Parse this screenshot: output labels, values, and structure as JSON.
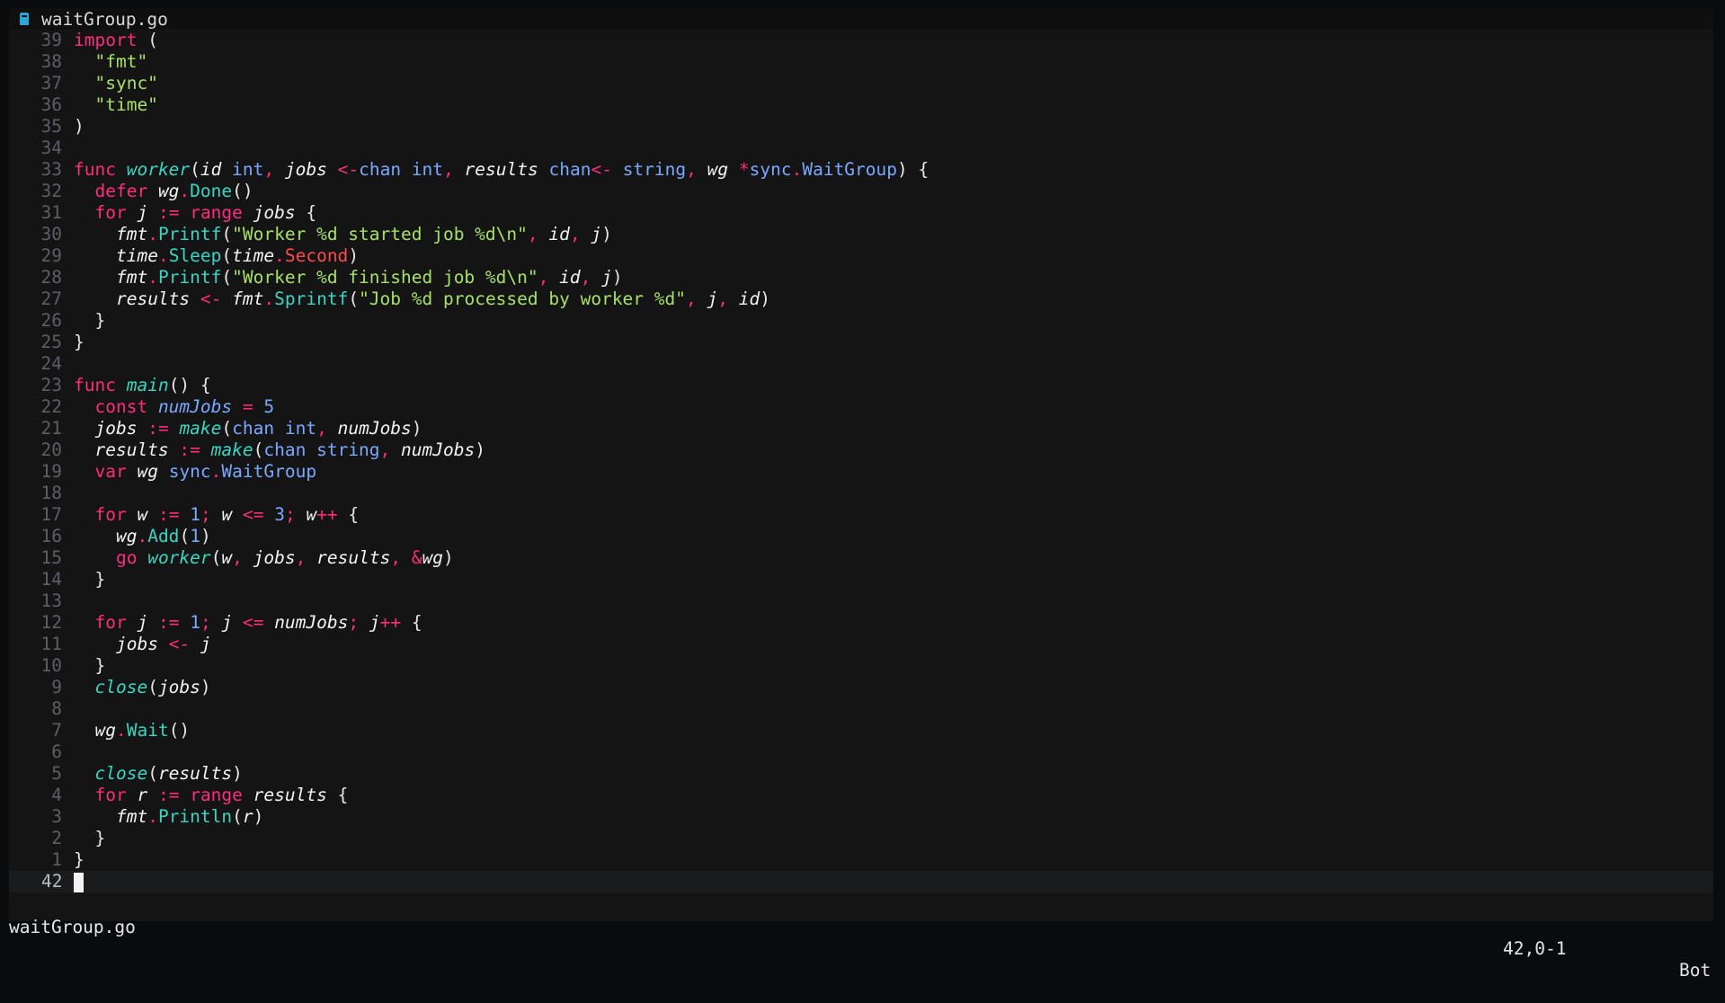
{
  "tab": {
    "icon": "file-icon",
    "title": "waitGroup.go"
  },
  "lines": [
    {
      "n": "39",
      "t": [
        [
          "k",
          "import"
        ],
        [
          "p",
          " ("
        ]
      ]
    },
    {
      "n": "38",
      "t": [
        [
          "p",
          "  "
        ],
        [
          "s",
          "\"fmt\""
        ]
      ]
    },
    {
      "n": "37",
      "t": [
        [
          "p",
          "  "
        ],
        [
          "s",
          "\"sync\""
        ]
      ]
    },
    {
      "n": "36",
      "t": [
        [
          "p",
          "  "
        ],
        [
          "s",
          "\"time\""
        ]
      ]
    },
    {
      "n": "35",
      "t": [
        [
          "p",
          ")"
        ]
      ]
    },
    {
      "n": "34",
      "t": []
    },
    {
      "n": "33",
      "t": [
        [
          "k",
          "func"
        ],
        [
          "p",
          " "
        ],
        [
          "f",
          "worker"
        ],
        [
          "p",
          "("
        ],
        [
          "v",
          "id"
        ],
        [
          "p",
          " "
        ],
        [
          "t",
          "int"
        ],
        [
          "k",
          ","
        ],
        [
          "p",
          " "
        ],
        [
          "v",
          "jobs"
        ],
        [
          "p",
          " "
        ],
        [
          "k",
          "<-"
        ],
        [
          "t",
          "chan"
        ],
        [
          "p",
          " "
        ],
        [
          "t",
          "int"
        ],
        [
          "k",
          ","
        ],
        [
          "p",
          " "
        ],
        [
          "v",
          "results"
        ],
        [
          "p",
          " "
        ],
        [
          "t",
          "chan"
        ],
        [
          "k",
          "<-"
        ],
        [
          "p",
          " "
        ],
        [
          "t",
          "string"
        ],
        [
          "k",
          ","
        ],
        [
          "p",
          " "
        ],
        [
          "v",
          "wg"
        ],
        [
          "p",
          " "
        ],
        [
          "k",
          "*"
        ],
        [
          "t",
          "sync"
        ],
        [
          "k",
          "."
        ],
        [
          "t",
          "WaitGroup"
        ],
        [
          "p",
          ") {"
        ]
      ]
    },
    {
      "n": "32",
      "t": [
        [
          "p",
          "  "
        ],
        [
          "k",
          "defer"
        ],
        [
          "p",
          " "
        ],
        [
          "v",
          "wg"
        ],
        [
          "k",
          "."
        ],
        [
          "m",
          "Done"
        ],
        [
          "p",
          "()"
        ]
      ]
    },
    {
      "n": "31",
      "t": [
        [
          "p",
          "  "
        ],
        [
          "k",
          "for"
        ],
        [
          "p",
          " "
        ],
        [
          "v",
          "j"
        ],
        [
          "p",
          " "
        ],
        [
          "k",
          ":="
        ],
        [
          "p",
          " "
        ],
        [
          "k",
          "range"
        ],
        [
          "p",
          " "
        ],
        [
          "v",
          "jobs"
        ],
        [
          "p",
          " {"
        ]
      ]
    },
    {
      "n": "30",
      "t": [
        [
          "p",
          "    "
        ],
        [
          "v",
          "fmt"
        ],
        [
          "k",
          "."
        ],
        [
          "m",
          "Printf"
        ],
        [
          "p",
          "("
        ],
        [
          "s",
          "\"Worker %d started job %d\\n\""
        ],
        [
          "k",
          ","
        ],
        [
          "p",
          " "
        ],
        [
          "v",
          "id"
        ],
        [
          "k",
          ","
        ],
        [
          "p",
          " "
        ],
        [
          "v",
          "j"
        ],
        [
          "p",
          ")"
        ]
      ]
    },
    {
      "n": "29",
      "t": [
        [
          "p",
          "    "
        ],
        [
          "v",
          "time"
        ],
        [
          "k",
          "."
        ],
        [
          "m",
          "Sleep"
        ],
        [
          "p",
          "("
        ],
        [
          "v",
          "time"
        ],
        [
          "k",
          "."
        ],
        [
          "c",
          "Second"
        ],
        [
          "p",
          ")"
        ]
      ]
    },
    {
      "n": "28",
      "t": [
        [
          "p",
          "    "
        ],
        [
          "v",
          "fmt"
        ],
        [
          "k",
          "."
        ],
        [
          "m",
          "Printf"
        ],
        [
          "p",
          "("
        ],
        [
          "s",
          "\"Worker %d finished job %d\\n\""
        ],
        [
          "k",
          ","
        ],
        [
          "p",
          " "
        ],
        [
          "v",
          "id"
        ],
        [
          "k",
          ","
        ],
        [
          "p",
          " "
        ],
        [
          "v",
          "j"
        ],
        [
          "p",
          ")"
        ]
      ]
    },
    {
      "n": "27",
      "t": [
        [
          "p",
          "    "
        ],
        [
          "v",
          "results"
        ],
        [
          "p",
          " "
        ],
        [
          "k",
          "<-"
        ],
        [
          "p",
          " "
        ],
        [
          "v",
          "fmt"
        ],
        [
          "k",
          "."
        ],
        [
          "m",
          "Sprintf"
        ],
        [
          "p",
          "("
        ],
        [
          "s",
          "\"Job %d processed by worker %d\""
        ],
        [
          "k",
          ","
        ],
        [
          "p",
          " "
        ],
        [
          "v",
          "j"
        ],
        [
          "k",
          ","
        ],
        [
          "p",
          " "
        ],
        [
          "v",
          "id"
        ],
        [
          "p",
          ")"
        ]
      ]
    },
    {
      "n": "26",
      "t": [
        [
          "p",
          "  }"
        ]
      ]
    },
    {
      "n": "25",
      "t": [
        [
          "p",
          "}"
        ]
      ]
    },
    {
      "n": "24",
      "t": []
    },
    {
      "n": "23",
      "t": [
        [
          "k",
          "func"
        ],
        [
          "p",
          " "
        ],
        [
          "f",
          "main"
        ],
        [
          "p",
          "() {"
        ]
      ]
    },
    {
      "n": "22",
      "t": [
        [
          "p",
          "  "
        ],
        [
          "k",
          "const"
        ],
        [
          "p",
          " "
        ],
        [
          "ci",
          "numJobs"
        ],
        [
          "p",
          " "
        ],
        [
          "k",
          "="
        ],
        [
          "p",
          " "
        ],
        [
          "n",
          "5"
        ]
      ]
    },
    {
      "n": "21",
      "t": [
        [
          "p",
          "  "
        ],
        [
          "v",
          "jobs"
        ],
        [
          "p",
          " "
        ],
        [
          "k",
          ":="
        ],
        [
          "p",
          " "
        ],
        [
          "f",
          "make"
        ],
        [
          "p",
          "("
        ],
        [
          "t",
          "chan"
        ],
        [
          "p",
          " "
        ],
        [
          "t",
          "int"
        ],
        [
          "k",
          ","
        ],
        [
          "p",
          " "
        ],
        [
          "v",
          "numJobs"
        ],
        [
          "p",
          ")"
        ]
      ]
    },
    {
      "n": "20",
      "t": [
        [
          "p",
          "  "
        ],
        [
          "v",
          "results"
        ],
        [
          "p",
          " "
        ],
        [
          "k",
          ":="
        ],
        [
          "p",
          " "
        ],
        [
          "f",
          "make"
        ],
        [
          "p",
          "("
        ],
        [
          "t",
          "chan"
        ],
        [
          "p",
          " "
        ],
        [
          "t",
          "string"
        ],
        [
          "k",
          ","
        ],
        [
          "p",
          " "
        ],
        [
          "v",
          "numJobs"
        ],
        [
          "p",
          ")"
        ]
      ]
    },
    {
      "n": "19",
      "t": [
        [
          "p",
          "  "
        ],
        [
          "k",
          "var"
        ],
        [
          "p",
          " "
        ],
        [
          "v",
          "wg"
        ],
        [
          "p",
          " "
        ],
        [
          "t",
          "sync"
        ],
        [
          "k",
          "."
        ],
        [
          "t",
          "WaitGroup"
        ]
      ]
    },
    {
      "n": "18",
      "t": []
    },
    {
      "n": "17",
      "t": [
        [
          "p",
          "  "
        ],
        [
          "k",
          "for"
        ],
        [
          "p",
          " "
        ],
        [
          "v",
          "w"
        ],
        [
          "p",
          " "
        ],
        [
          "k",
          ":="
        ],
        [
          "p",
          " "
        ],
        [
          "n",
          "1"
        ],
        [
          "k",
          ";"
        ],
        [
          "p",
          " "
        ],
        [
          "v",
          "w"
        ],
        [
          "p",
          " "
        ],
        [
          "k",
          "<="
        ],
        [
          "p",
          " "
        ],
        [
          "n",
          "3"
        ],
        [
          "k",
          ";"
        ],
        [
          "p",
          " "
        ],
        [
          "v",
          "w"
        ],
        [
          "k",
          "++"
        ],
        [
          "p",
          " {"
        ]
      ]
    },
    {
      "n": "16",
      "t": [
        [
          "p",
          "    "
        ],
        [
          "v",
          "wg"
        ],
        [
          "k",
          "."
        ],
        [
          "m",
          "Add"
        ],
        [
          "p",
          "("
        ],
        [
          "n",
          "1"
        ],
        [
          "p",
          ")"
        ]
      ]
    },
    {
      "n": "15",
      "t": [
        [
          "p",
          "    "
        ],
        [
          "k",
          "go"
        ],
        [
          "p",
          " "
        ],
        [
          "f",
          "worker"
        ],
        [
          "p",
          "("
        ],
        [
          "v",
          "w"
        ],
        [
          "k",
          ","
        ],
        [
          "p",
          " "
        ],
        [
          "v",
          "jobs"
        ],
        [
          "k",
          ","
        ],
        [
          "p",
          " "
        ],
        [
          "v",
          "results"
        ],
        [
          "k",
          ","
        ],
        [
          "p",
          " "
        ],
        [
          "k",
          "&"
        ],
        [
          "v",
          "wg"
        ],
        [
          "p",
          ")"
        ]
      ]
    },
    {
      "n": "14",
      "t": [
        [
          "p",
          "  }"
        ]
      ]
    },
    {
      "n": "13",
      "t": []
    },
    {
      "n": "12",
      "t": [
        [
          "p",
          "  "
        ],
        [
          "k",
          "for"
        ],
        [
          "p",
          " "
        ],
        [
          "v",
          "j"
        ],
        [
          "p",
          " "
        ],
        [
          "k",
          ":="
        ],
        [
          "p",
          " "
        ],
        [
          "n",
          "1"
        ],
        [
          "k",
          ";"
        ],
        [
          "p",
          " "
        ],
        [
          "v",
          "j"
        ],
        [
          "p",
          " "
        ],
        [
          "k",
          "<="
        ],
        [
          "p",
          " "
        ],
        [
          "v",
          "numJobs"
        ],
        [
          "k",
          ";"
        ],
        [
          "p",
          " "
        ],
        [
          "v",
          "j"
        ],
        [
          "k",
          "++"
        ],
        [
          "p",
          " {"
        ]
      ]
    },
    {
      "n": "11",
      "t": [
        [
          "p",
          "    "
        ],
        [
          "v",
          "jobs"
        ],
        [
          "p",
          " "
        ],
        [
          "k",
          "<-"
        ],
        [
          "p",
          " "
        ],
        [
          "v",
          "j"
        ]
      ]
    },
    {
      "n": "10",
      "t": [
        [
          "p",
          "  }"
        ]
      ]
    },
    {
      "n": "9",
      "t": [
        [
          "p",
          "  "
        ],
        [
          "f",
          "close"
        ],
        [
          "p",
          "("
        ],
        [
          "v",
          "jobs"
        ],
        [
          "p",
          ")"
        ]
      ]
    },
    {
      "n": "8",
      "t": []
    },
    {
      "n": "7",
      "t": [
        [
          "p",
          "  "
        ],
        [
          "v",
          "wg"
        ],
        [
          "k",
          "."
        ],
        [
          "m",
          "Wait"
        ],
        [
          "p",
          "()"
        ]
      ]
    },
    {
      "n": "6",
      "t": []
    },
    {
      "n": "5",
      "t": [
        [
          "p",
          "  "
        ],
        [
          "f",
          "close"
        ],
        [
          "p",
          "("
        ],
        [
          "v",
          "results"
        ],
        [
          "p",
          ")"
        ]
      ]
    },
    {
      "n": "4",
      "t": [
        [
          "p",
          "  "
        ],
        [
          "k",
          "for"
        ],
        [
          "p",
          " "
        ],
        [
          "v",
          "r"
        ],
        [
          "p",
          " "
        ],
        [
          "k",
          ":="
        ],
        [
          "p",
          " "
        ],
        [
          "k",
          "range"
        ],
        [
          "p",
          " "
        ],
        [
          "v",
          "results"
        ],
        [
          "p",
          " {"
        ]
      ]
    },
    {
      "n": "3",
      "t": [
        [
          "p",
          "    "
        ],
        [
          "v",
          "fmt"
        ],
        [
          "k",
          "."
        ],
        [
          "m",
          "Println"
        ],
        [
          "p",
          "("
        ],
        [
          "v",
          "r"
        ],
        [
          "p",
          ")"
        ]
      ]
    },
    {
      "n": "2",
      "t": [
        [
          "p",
          "  }"
        ]
      ]
    },
    {
      "n": "1",
      "t": [
        [
          "p",
          "}"
        ]
      ]
    }
  ],
  "cursor_line": {
    "n": "42"
  },
  "status": {
    "file": "waitGroup.go",
    "position": "42,0-1",
    "scroll": "Bot"
  }
}
